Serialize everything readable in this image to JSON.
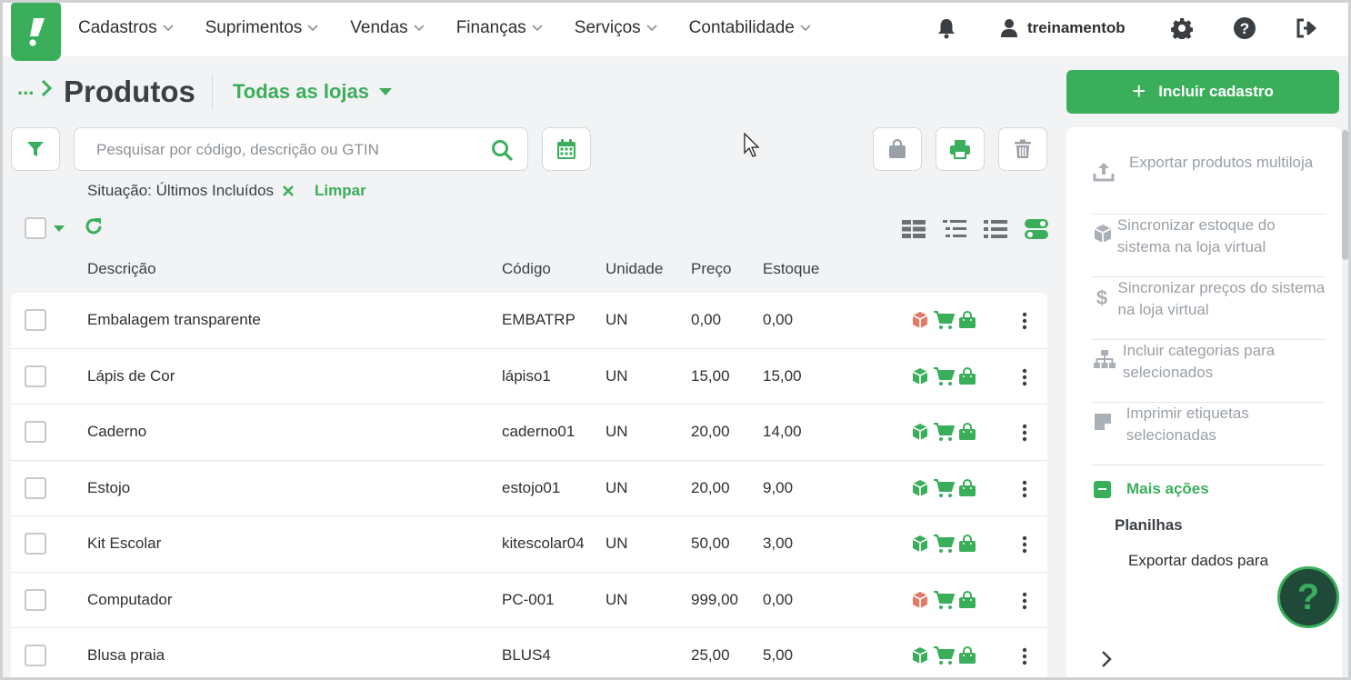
{
  "nav": {
    "items": [
      {
        "label": "Cadastros"
      },
      {
        "label": "Suprimentos"
      },
      {
        "label": "Vendas"
      },
      {
        "label": "Finanças"
      },
      {
        "label": "Serviços"
      },
      {
        "label": "Contabilidade"
      }
    ],
    "username": "treinamentob"
  },
  "header": {
    "breadcrumb": "...",
    "title": "Produtos",
    "store_selector": "Todas as lojas",
    "include_button": "Incluir cadastro"
  },
  "search": {
    "placeholder": "Pesquisar por código, descrição ou GTIN",
    "value": ""
  },
  "filter": {
    "label": "Situação: Últimos Incluídos",
    "clear_label": "Limpar"
  },
  "table": {
    "columns": [
      "Descrição",
      "Código",
      "Unidade",
      "Preço",
      "Estoque"
    ],
    "rows": [
      {
        "descricao": "Embalagem transparente",
        "codigo": "EMBATRP",
        "unidade": "UN",
        "preco": "0,00",
        "estoque": "0,00",
        "stock_status": "out"
      },
      {
        "descricao": "Lápis de Cor",
        "codigo": "lápiso1",
        "unidade": "UN",
        "preco": "15,00",
        "estoque": "15,00",
        "stock_status": "in"
      },
      {
        "descricao": "Caderno",
        "codigo": "caderno01",
        "unidade": "UN",
        "preco": "20,00",
        "estoque": "14,00",
        "stock_status": "in"
      },
      {
        "descricao": "Estojo",
        "codigo": "estojo01",
        "unidade": "UN",
        "preco": "20,00",
        "estoque": "9,00",
        "stock_status": "in"
      },
      {
        "descricao": "Kit Escolar",
        "codigo": "kitescolar04",
        "unidade": "UN",
        "preco": "50,00",
        "estoque": "3,00",
        "stock_status": "in"
      },
      {
        "descricao": "Computador",
        "codigo": "PC-001",
        "unidade": "UN",
        "preco": "999,00",
        "estoque": "0,00",
        "stock_status": "out"
      },
      {
        "descricao": "Blusa praia",
        "codigo": "BLUS4",
        "unidade": "",
        "preco": "25,00",
        "estoque": "5,00",
        "stock_status": "in"
      }
    ]
  },
  "side_panel": {
    "items": [
      {
        "label": "Exportar produtos multiloja",
        "icon": "upload-icon"
      },
      {
        "label": "Sincronizar estoque do sistema na loja virtual",
        "icon": "box-icon"
      },
      {
        "label": "Sincronizar preços do sistema na loja virtual",
        "icon": "dollar-icon"
      },
      {
        "label": "Incluir categorias para selecionados",
        "icon": "sitemap-icon"
      },
      {
        "label": "Imprimir etiquetas selecionadas",
        "icon": "label-icon"
      }
    ],
    "more_actions": "Mais ações",
    "section_title": "Planilhas",
    "section_item": "Exportar dados para"
  },
  "help_fab": "?",
  "colors": {
    "accent": "#3aae5b",
    "out_of_stock": "#e07a6b",
    "muted": "#9aa0a6"
  }
}
